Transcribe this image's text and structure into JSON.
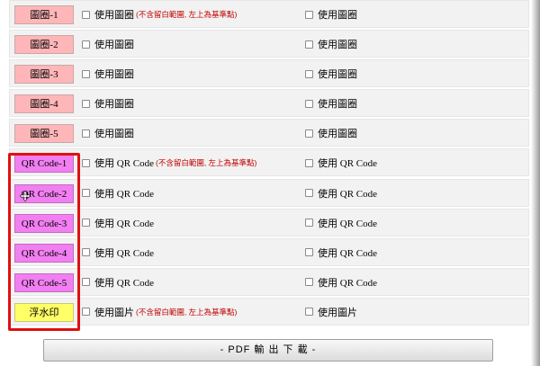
{
  "rows": [
    {
      "tag": "圖圈-1",
      "type": "circle",
      "opt1": "使用圖圈",
      "note": "(不含留白範圍, 左上為基準點)",
      "opt2": "使用圖圈"
    },
    {
      "tag": "圖圈-2",
      "type": "circle",
      "opt1": "使用圖圈",
      "note": "",
      "opt2": "使用圖圈"
    },
    {
      "tag": "圖圈-3",
      "type": "circle",
      "opt1": "使用圖圈",
      "note": "",
      "opt2": "使用圖圈"
    },
    {
      "tag": "圖圈-4",
      "type": "circle",
      "opt1": "使用圖圈",
      "note": "",
      "opt2": "使用圖圈"
    },
    {
      "tag": "圖圈-5",
      "type": "circle",
      "opt1": "使用圖圈",
      "note": "",
      "opt2": "使用圖圈"
    },
    {
      "tag": "QR Code-1",
      "type": "qr",
      "opt1": "使用 QR Code",
      "note": "(不含留白範圍, 左上為基準點)",
      "opt2": "使用 QR Code"
    },
    {
      "tag": "QR Code-2",
      "type": "qr",
      "opt1": "使用 QR Code",
      "note": "",
      "opt2": "使用 QR Code"
    },
    {
      "tag": "QR Code-3",
      "type": "qr",
      "opt1": "使用 QR Code",
      "note": "",
      "opt2": "使用 QR Code"
    },
    {
      "tag": "QR Code-4",
      "type": "qr",
      "opt1": "使用 QR Code",
      "note": "",
      "opt2": "使用 QR Code"
    },
    {
      "tag": "QR Code-5",
      "type": "qr",
      "opt1": "使用 QR Code",
      "note": "",
      "opt2": "使用 QR Code"
    },
    {
      "tag": "浮水印",
      "type": "wm",
      "opt1": "使用圖片",
      "note": "(不含留白範圍, 左上為基準點)",
      "opt2": "使用圖片"
    }
  ],
  "pdf_button_label": "- PDF 輸 出 下 載 -",
  "colors": {
    "circle": "#ffb6b9",
    "qr": "#f27ff1",
    "watermark": "#ffff66",
    "note": "#c00000",
    "highlight": "#e01010"
  }
}
